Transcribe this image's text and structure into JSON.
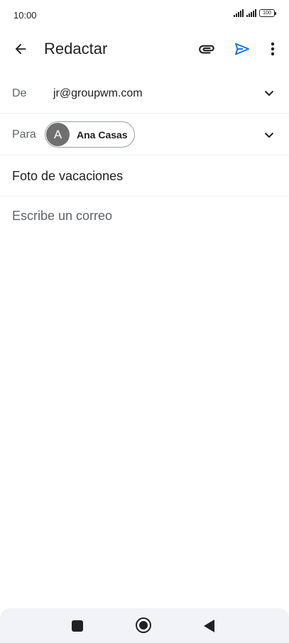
{
  "status_bar": {
    "time": "10:00",
    "battery": "100"
  },
  "app_bar": {
    "title": "Redactar",
    "icons": [
      "back-arrow-icon",
      "attachment-icon",
      "send-icon",
      "more-vert-icon"
    ],
    "send_color": "#1a73e8"
  },
  "compose": {
    "from_label": "De",
    "from_value": "jr@groupwm.com",
    "to_label": "Para",
    "to_chip": {
      "initial": "A",
      "name": "Ana Casas"
    },
    "subject": "Foto de vacaciones",
    "body_placeholder": "Escribe un correo"
  },
  "nav_bar": {
    "icons": [
      "recents-square-icon",
      "home-circle-icon",
      "back-triangle-icon"
    ]
  }
}
